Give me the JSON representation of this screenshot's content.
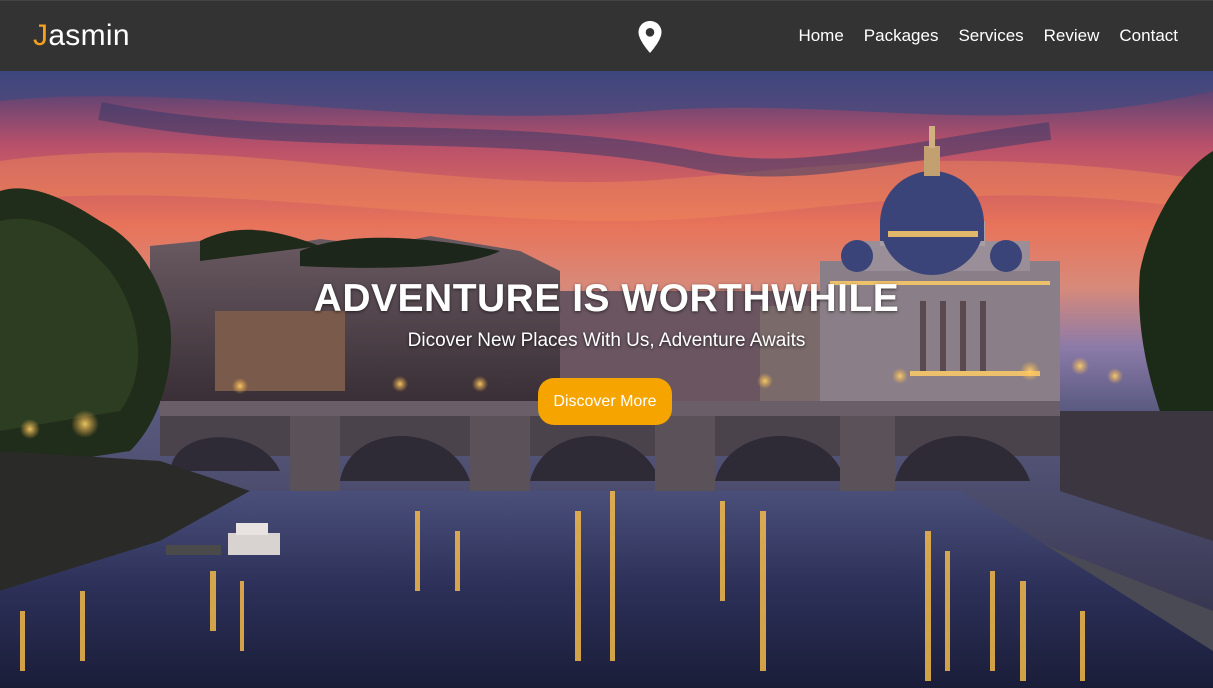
{
  "brand": {
    "first_letter": "J",
    "rest": "asmin",
    "accent_color": "#f5a11c"
  },
  "header_icon": "location-pin-icon",
  "nav": [
    {
      "label": "Home"
    },
    {
      "label": "Packages"
    },
    {
      "label": "Services"
    },
    {
      "label": "Review"
    },
    {
      "label": "Contact"
    }
  ],
  "hero": {
    "title": "ADVENTURE IS WORTHWHILE",
    "subtitle": "Dicover New Places With Us, Adventure Awaits",
    "cta_label": "Discover More",
    "cta_color": "#f5a400",
    "background": "city-bridge-sunset-image"
  }
}
